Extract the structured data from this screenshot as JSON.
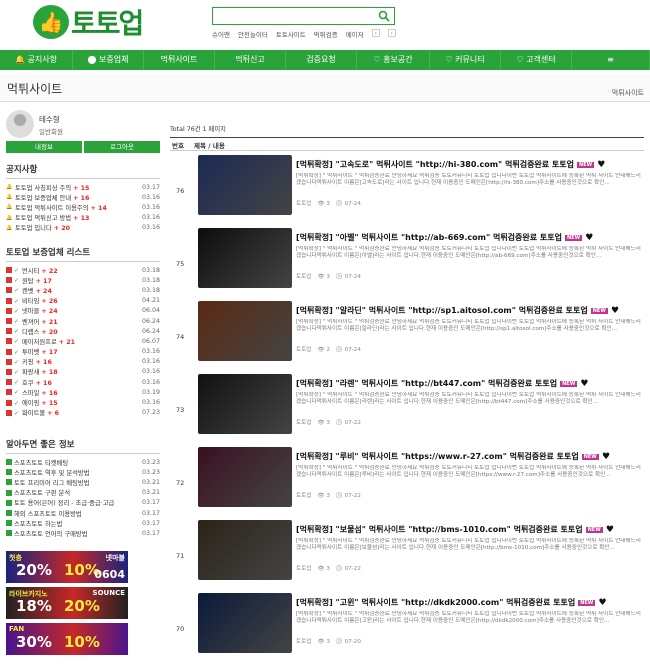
{
  "header": {
    "logo_text": "토토업",
    "logo_icon": "thumbs-up-icon",
    "search_placeholder": "",
    "top_links": [
      "슈어맨",
      "안전놀이터",
      "토토사이트",
      "먹튀검증",
      "메이저"
    ],
    "page_prev": "‹",
    "page_next": "›"
  },
  "nav": [
    "공지사항",
    "보증업체",
    "먹튀사이트",
    "먹튀신고",
    "검증요청",
    "홍보공간",
    "커뮤니티",
    "고객센터",
    "≡"
  ],
  "page": {
    "title": "먹튀사이트",
    "breadcrumb": "먹튀사이트"
  },
  "profile": {
    "name": "테수형",
    "level": "일반회원",
    "btn_info": "내정보",
    "btn_logout": "로그아웃"
  },
  "notice": {
    "title": "공지사항",
    "items": [
      {
        "text": "토토업 사칭피싱 주의",
        "count": "+ 15",
        "date": "03.17"
      },
      {
        "text": "토토업 보증업체 안내",
        "count": "+ 16",
        "date": "03.16"
      },
      {
        "text": "토토업 먹튀사이트 이용주의",
        "count": "+ 14",
        "date": "03.16"
      },
      {
        "text": "토토업 먹튀신고 방법",
        "count": "+ 13",
        "date": "03.16"
      },
      {
        "text": "토토업 입니다",
        "count": "+ 20",
        "date": "03.16"
      }
    ]
  },
  "partners": {
    "title": "토토업 보증업체 리스트",
    "items": [
      {
        "text": "먼시티",
        "count": "+ 22",
        "date": "03.18"
      },
      {
        "text": "원탑",
        "count": "+ 17",
        "date": "03.18"
      },
      {
        "text": "캔벳",
        "count": "+ 24",
        "date": "03.18"
      },
      {
        "text": "비타임",
        "count": "+ 26",
        "date": "04.21"
      },
      {
        "text": "넷마블",
        "count": "+ 24",
        "date": "06.04"
      },
      {
        "text": "벤져어",
        "count": "+ 21",
        "date": "06.24"
      },
      {
        "text": "디랩스",
        "count": "+ 20",
        "date": "06.24"
      },
      {
        "text": "메이저원프로",
        "count": "+ 21",
        "date": "06.07"
      },
      {
        "text": "투미벳",
        "count": "+ 17",
        "date": "03.16"
      },
      {
        "text": "키핑",
        "count": "+ 16",
        "date": "03.16"
      },
      {
        "text": "파랑새",
        "count": "+ 18",
        "date": "03.16"
      },
      {
        "text": "호쿠",
        "count": "+ 16",
        "date": "03.16"
      },
      {
        "text": "스마일",
        "count": "+ 16",
        "date": "03.19"
      },
      {
        "text": "에이핑",
        "count": "+ 15",
        "date": "03.16"
      },
      {
        "text": "화이트볼",
        "count": "+ 6",
        "date": "07.23"
      }
    ]
  },
  "info": {
    "title": "알아두면 좋은 정보",
    "items": [
      {
        "text": "스포츠토토 티켓배팅",
        "date": "03.23"
      },
      {
        "text": "스포츠토토 역후 및 분석방법",
        "date": "03.23"
      },
      {
        "text": "토토 프리미어 리그 배팅방법",
        "date": "03.21"
      },
      {
        "text": "스포츠토토 구판 분석",
        "date": "03.21"
      },
      {
        "text": "토토 용어(은어) 정리 - 초급·중급·고급",
        "date": "03.17"
      },
      {
        "text": "해외 스포츠토토 이용방법",
        "date": "03.17"
      },
      {
        "text": "스포츠토토 하는법",
        "date": "03.17"
      },
      {
        "text": "스포츠토토 언어의 구매방법",
        "date": "03.17"
      }
    ]
  },
  "banners": [
    {
      "line1": "첫충",
      "line2": "20%",
      "line3": "10%",
      "brand": "넷마블",
      "code": "0604",
      "color": "#1a237e"
    },
    {
      "line1": "라이브카지노",
      "line2": "18%",
      "line3": "20%",
      "brand": "SOUNCE",
      "code": "",
      "color": "#222"
    },
    {
      "line1": "FAN",
      "line2": "30%",
      "line3": "10%",
      "brand": "",
      "code": "",
      "color": "#4a148c"
    }
  ],
  "list": {
    "total": "Total 76건 1 페이지",
    "col_no": "번호",
    "col_title": "제목 / 내용",
    "posts": [
      {
        "no": "76",
        "title": "[먹튀확정] \"고속도로\" 먹튀사이트 \"http://hi-380.com\" 먹튀검증완료 토토업",
        "excerpt": "[먹튀확정] \" 먹튀사이트 \" 먹튀검증완료 안녕하세요 먹튀검증 토토커뮤니티 토토업 입니다이번 토토업 먹튀사이트에 등록된 먹튀 사이트 안내해드리겠습니다먹튀사이트 이름은[고속도로]라는 사이트 입니다.현재 이용중인 도메인은[http://hi-380.com]주소를 사용중인것으로 확인...",
        "author": "토토업",
        "views": "3",
        "date": "07-24",
        "thumb": "#1c2a55"
      },
      {
        "no": "75",
        "title": "[먹튀확정] \"아벨\" 먹튀사이트 \"http://ab-669.com\" 먹튀검증완료 토토업",
        "excerpt": "[먹튀확정] \" 먹튀사이트 \" 먹튀검증완료 안녕하세요 먹튀검증 토토커뮤니티 토토업 입니다이번 토토업 먹튀사이트에 등록된 먹튀 사이트 안내해드리겠습니다먹튀사이트 이름은[아벨]라는 사이트 입니다.현재 이용중인 도메인은[http://ab-669.com]주소를 사용중인것으로 확인...",
        "author": "토토업",
        "views": "3",
        "date": "07-24",
        "thumb": "#0d0d0d"
      },
      {
        "no": "74",
        "title": "[먹튀확정] \"알라딘\" 먹튀사이트 \"http://sp1.aitosol.com\" 먹튀검증완료 토토업",
        "excerpt": "[먹튀확정] \" 먹튀사이트 \" 먹튀검증완료 안녕하세요 먹튀검증 토토커뮤니티 토토업 입니다이번 토토업 먹튀사이트에 등록된 먹튀 사이트 안내해드리겠습니다먹튀사이트 이름은[알라딘]라는 사이트 입니다.현재 이용중인 도메인은[http://sp1.aitosol.com]주소를 사용중인것으로 확인...",
        "author": "토토업",
        "views": "2",
        "date": "07-24",
        "thumb": "#5a2a12"
      },
      {
        "no": "73",
        "title": "[먹튀확정] \"라렌\" 먹튀사이트 \"http://bt447.com\" 먹튀검증완료 토토업",
        "excerpt": "[먹튀확정] \" 먹튀사이트 \" 먹튀검증완료 안녕하세요 먹튀검증 토토커뮤니티 토토업 입니다이번 토토업 먹튀사이트에 등록된 먹튀 사이트 안내해드리겠습니다먹튀사이트 이름은[라렌]라는 사이트 입니다.현재 이용중인 도메인은[http://bt447.com]주소를 사용중인것으로 확인...",
        "author": "토토업",
        "views": "3",
        "date": "07-22",
        "thumb": "#111111"
      },
      {
        "no": "72",
        "title": "[먹튀확정] \"루비\" 먹튀사이트 \"https://www.r-27.com\" 먹튀검증완료 토토업",
        "excerpt": "[먹튀확정] \" 먹튀사이트 \" 먹튀검증완료 안녕하세요 먹튀검증 토토커뮤니티 토토업 입니다이번 토토업 먹튀사이트에 등록된 먹튀 사이트 안내해드리겠습니다먹튀사이트 이름은[루비]라는 사이트 입니다.현재 이용중인 도메인은[https://www.r-27.com]주소를 사용중인것으로 확인...",
        "author": "토토업",
        "views": "3",
        "date": "07-22",
        "thumb": "#3a1020"
      },
      {
        "no": "71",
        "title": "[먹튀확정] \"보물섬\" 먹튀사이트 \"http://bms-1010.com\" 먹튀검증완료 토토업",
        "excerpt": "[먹튀확정] \" 먹튀사이트 \" 먹튀검증완료 안녕하세요 먹튀검증 토토커뮤니티 토토업 입니다이번 토토업 먹튀사이트에 등록된 먹튀 사이트 안내해드리겠습니다먹튀사이트 이름은[보물섬]라는 사이트 입니다.현재 이용중인 도메인은[http://bms-1010.com]주소를 사용중인것으로 확인...",
        "author": "토토업",
        "views": "3",
        "date": "07-22",
        "thumb": "#2b2418"
      },
      {
        "no": "70",
        "title": "[먹튀확정] \"고윈\" 먹튀사이트 \"http://dkdk2000.com\" 먹튀검증완료 토토업",
        "excerpt": "[먹튀확정] \" 먹튀사이트 \" 먹튀검증완료 안녕하세요 먹튀검증 토토커뮤니티 토토업 입니다이번 토토업 먹튀사이트에 등록된 먹튀 사이트 안내해드리겠습니다먹튀사이트 이름은[고윈]라는 사이트 입니다.현재 이용중인 도메인은[http://dkdk2000.com]주소를 사용중인것으로 확인...",
        "author": "토토업",
        "views": "3",
        "date": "07-20",
        "thumb": "#0a1a3a"
      }
    ]
  },
  "colors": {
    "brand": "#2aa43a",
    "accent_red": "#e22222",
    "new_badge": "#c0368c"
  },
  "icons": {
    "search": "search-icon",
    "heart": "heart-icon",
    "bell": "bell-icon"
  }
}
